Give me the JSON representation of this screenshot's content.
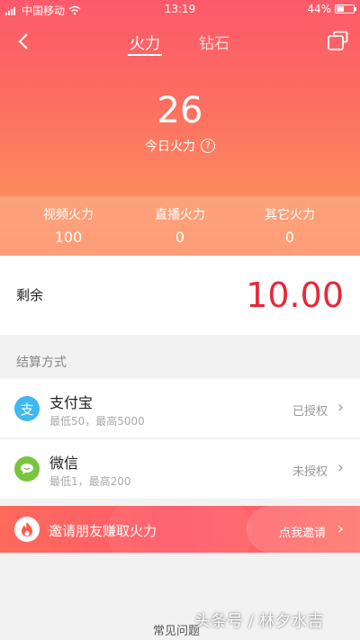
{
  "status_bar": {
    "carrier": "中国移动",
    "time": "13:19",
    "battery": "44%",
    "battery_level": 0.44
  },
  "nav": {
    "tabs": [
      {
        "label": "火力",
        "active": true
      },
      {
        "label": "钻石",
        "active": false
      }
    ]
  },
  "today": {
    "value": "26",
    "label": "今日火力"
  },
  "stats": [
    {
      "label": "视频火力",
      "value": "100"
    },
    {
      "label": "直播火力",
      "value": "0"
    },
    {
      "label": "其它火力",
      "value": "0"
    }
  ],
  "balance": {
    "label": "剩余",
    "amount": "10.00"
  },
  "settlement": {
    "title": "结算方式",
    "methods": [
      {
        "name": "支付宝",
        "limits": "最低50，最高5000",
        "status": "已授权",
        "icon": "alipay-icon",
        "color": "#3fb7ef"
      },
      {
        "name": "微信",
        "limits": "最低1，最高200",
        "status": "未授权",
        "icon": "wechat-icon",
        "color": "#7ac53f"
      }
    ]
  },
  "invite": {
    "text": "邀请朋友赚取火力",
    "cta": "点我邀请"
  },
  "footer": {
    "faq": "常见问题"
  },
  "watermark": "头条号 / 林夕水吉",
  "colors": {
    "accent": "#fc5a6a",
    "amount": "#e6283a"
  }
}
